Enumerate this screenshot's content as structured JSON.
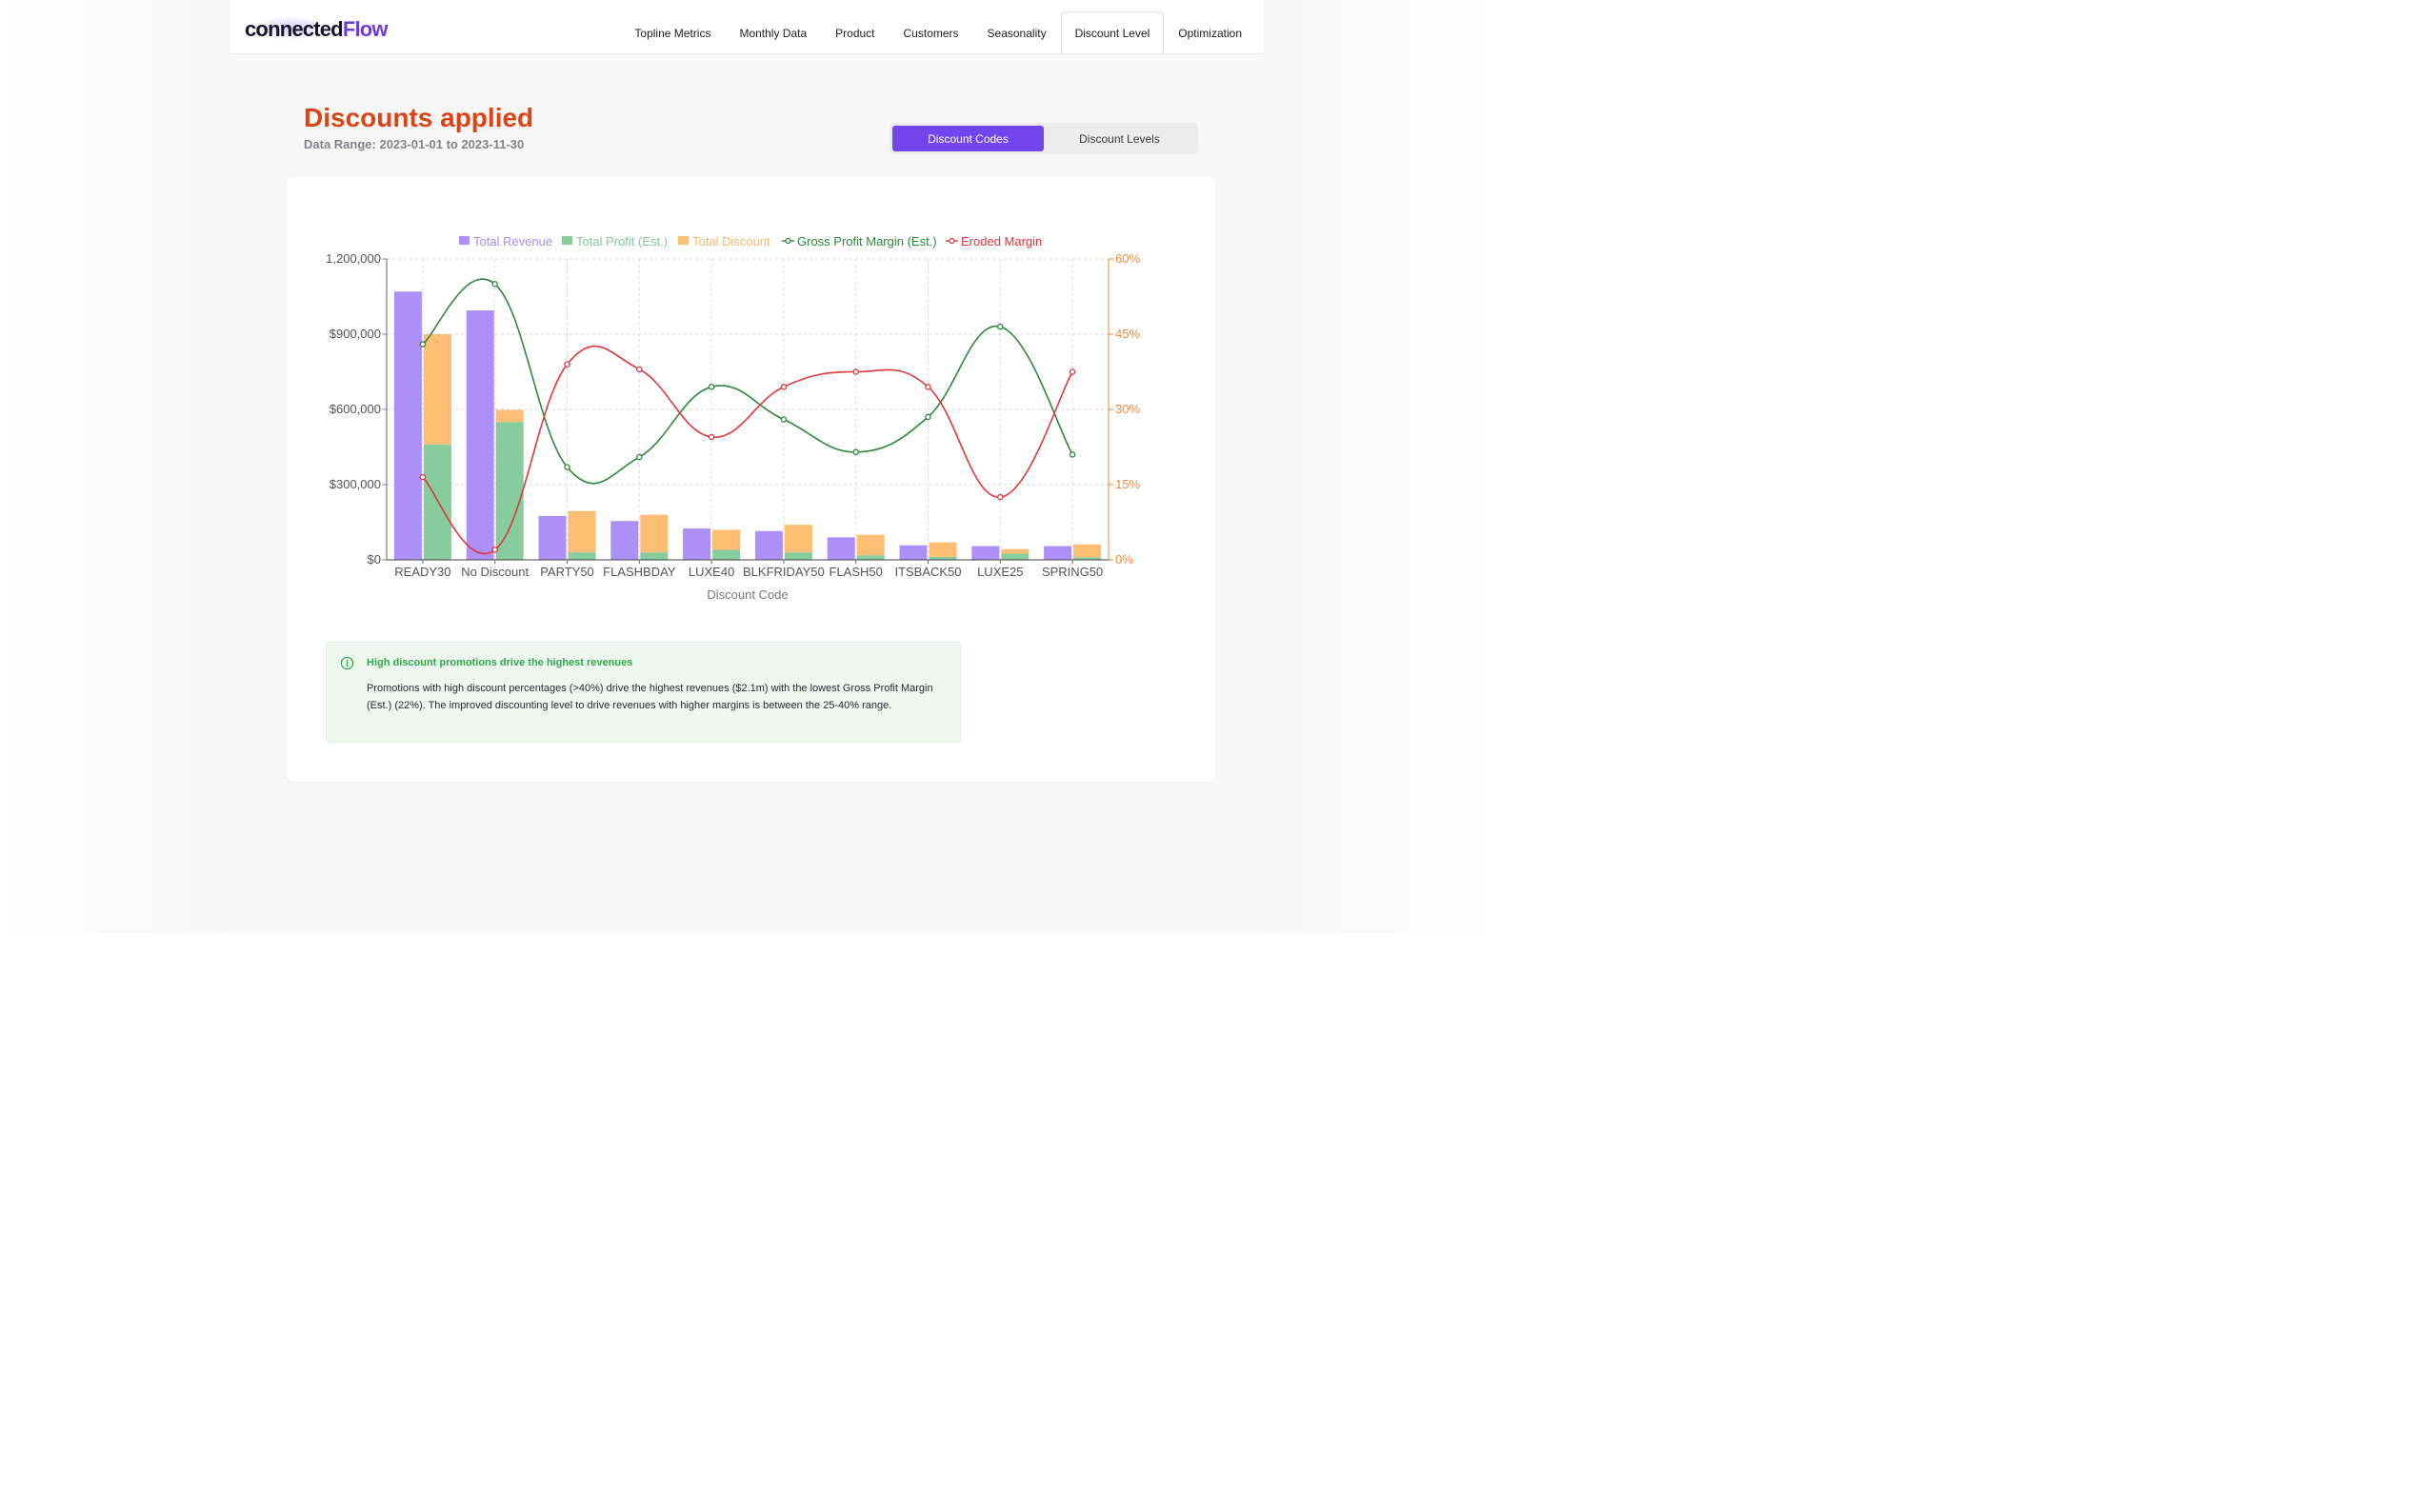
{
  "app": {
    "logo_part1": "connected",
    "logo_part2": "Flow",
    "nav": [
      "Topline Metrics",
      "Monthly Data",
      "Product",
      "Customers",
      "Seasonality",
      "Discount Level",
      "Optimization"
    ],
    "active_nav": "Discount Level"
  },
  "page": {
    "title": "Discounts applied",
    "subtitle": "Data Range: 2023-01-01 to 2023-11-30",
    "toggle": {
      "codes_label": "Discount Codes",
      "levels_label": "Discount Levels",
      "active": "Discount Codes"
    }
  },
  "colors": {
    "title": "#dd4415",
    "accent": "#7345ee",
    "revenue": "#ad90f7",
    "profit": "#86cc9d",
    "discount": "#fdbe73",
    "margin": "#2b8a3a",
    "eroded": "#e0373a",
    "right_axis": "#f08a3c",
    "insight_bg": "#eef8ef",
    "insight_title": "#2fa84a"
  },
  "chart_data": {
    "type": "bar",
    "categories": [
      "READY30",
      "No Discount",
      "PARTY50",
      "FLASHBDAY",
      "LUXE40",
      "BLKFRIDAY50",
      "FLASH50",
      "ITSBACK50",
      "LUXE25",
      "SPRING50"
    ],
    "series": [
      {
        "name": "Total Revenue",
        "type": "bar",
        "axis": "left",
        "values": [
          1070000,
          995000,
          175000,
          155000,
          125000,
          115000,
          90000,
          58000,
          55000,
          55000
        ]
      },
      {
        "name": "Total Profit (Est.)",
        "type": "bar-stacked",
        "stack": "s2",
        "axis": "left",
        "values": [
          460000,
          550000,
          30000,
          30000,
          40000,
          30000,
          18000,
          12000,
          25000,
          10000
        ]
      },
      {
        "name": "Total Discount",
        "type": "bar-stacked",
        "stack": "s2",
        "axis": "left",
        "values": [
          440000,
          48000,
          165000,
          150000,
          80000,
          110000,
          82000,
          58000,
          18000,
          52000
        ]
      },
      {
        "name": "Gross Profit Margin (Est.)",
        "type": "line",
        "axis": "right",
        "values": [
          43,
          55,
          18.5,
          20.5,
          34.5,
          28,
          21.5,
          28.5,
          46.5,
          21
        ]
      },
      {
        "name": "Eroded Margin",
        "type": "line",
        "axis": "right",
        "values": [
          16.5,
          2,
          39,
          38,
          24.5,
          34.5,
          37.5,
          34.5,
          12.5,
          37.5
        ]
      }
    ],
    "xlabel": "Discount Code",
    "ylabel": "",
    "ylim": [
      0,
      1200000
    ],
    "y_ticks": [
      "$0",
      "$300,000",
      "$600,000",
      "$900,000",
      "1,200,000"
    ],
    "y2lim": [
      0,
      60
    ],
    "y2_ticks": [
      "0%",
      "15%",
      "30%",
      "45%",
      "60%"
    ],
    "grid": true,
    "legend_position": "top-center"
  },
  "insight": {
    "title": "High discount promotions drive the highest revenues",
    "body": "Promotions with high discount percentages (>40%) drive the highest revenues ($2.1m) with the lowest Gross Profit Margin (Est.) (22%). The improved discounting level to drive revenues with higher margins is between the 25-40% range.",
    "icon": "info-icon"
  }
}
